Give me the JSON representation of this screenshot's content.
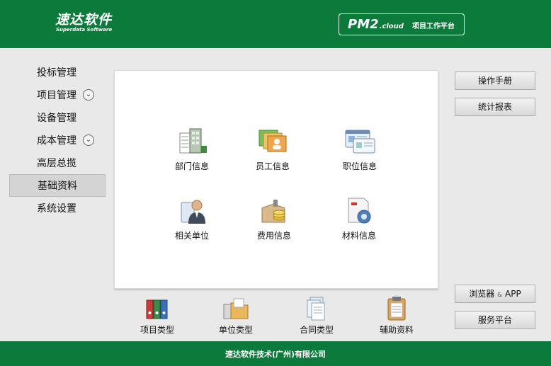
{
  "header": {
    "logo_cn": "速达软件",
    "logo_en": "Superdata Software",
    "product_main": "PM2",
    "product_suffix": ".cloud",
    "product_sub": "项目工作平台"
  },
  "sidebar": {
    "items": [
      {
        "label": "投标管理",
        "expandable": false
      },
      {
        "label": "项目管理",
        "expandable": true
      },
      {
        "label": "设备管理",
        "expandable": false
      },
      {
        "label": "成本管理",
        "expandable": true
      },
      {
        "label": "高层总揽",
        "expandable": false
      },
      {
        "label": "基础资料",
        "expandable": false,
        "active": true
      },
      {
        "label": "系统设置",
        "expandable": false
      }
    ],
    "expand_glyph": "⌄"
  },
  "main": {
    "tiles": [
      {
        "label": "部门信息",
        "icon": "department-icon"
      },
      {
        "label": "员工信息",
        "icon": "employee-icon"
      },
      {
        "label": "职位信息",
        "icon": "position-icon"
      },
      {
        "label": "相关单位",
        "icon": "related-unit-icon"
      },
      {
        "label": "费用信息",
        "icon": "expense-icon"
      },
      {
        "label": "材料信息",
        "icon": "material-icon"
      }
    ]
  },
  "bottom": {
    "tiles": [
      {
        "label": "项目类型",
        "icon": "binders-icon"
      },
      {
        "label": "单位类型",
        "icon": "folder-icon"
      },
      {
        "label": "合同类型",
        "icon": "documents-icon"
      },
      {
        "label": "辅助资料",
        "icon": "clipboard-icon"
      }
    ]
  },
  "right": {
    "manual": "操作手册",
    "reports": "统计报表",
    "browser_a": "浏览器",
    "browser_amp": "&",
    "browser_b": "APP",
    "service": "服务平台"
  },
  "footer": {
    "text": "速达软件技术(广州)有限公司"
  },
  "colors": {
    "brand_green": "#0b7a3b"
  }
}
